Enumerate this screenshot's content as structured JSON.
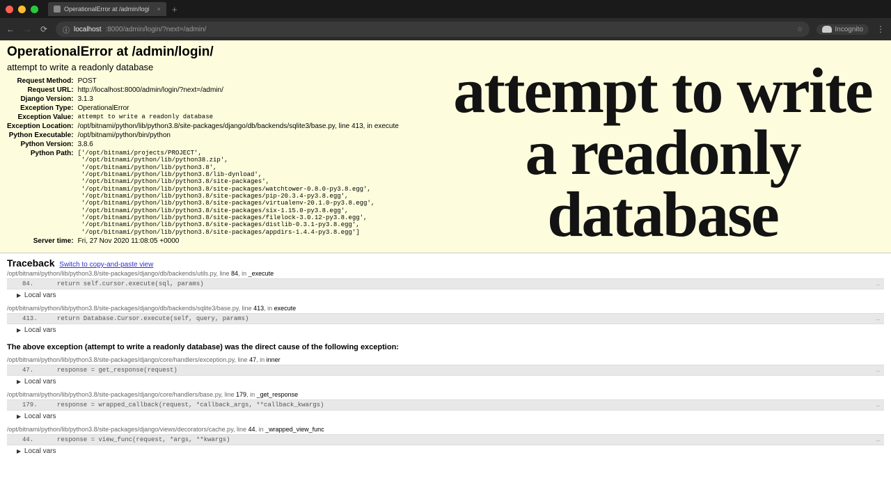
{
  "chrome": {
    "tab_title": "OperationalError at /admin/logi",
    "url_host": "localhost",
    "url_path": ":8000/admin/login/?next=/admin/",
    "incognito_label": "Incognito"
  },
  "summary": {
    "title": "OperationalError at /admin/login/",
    "subtitle": "attempt to write a readonly database",
    "rows": [
      {
        "label": "Request Method:",
        "value": "POST"
      },
      {
        "label": "Request URL:",
        "value": "http://localhost:8000/admin/login/?next=/admin/"
      },
      {
        "label": "Django Version:",
        "value": "3.1.3"
      },
      {
        "label": "Exception Type:",
        "value": "OperationalError"
      },
      {
        "label": "Exception Value:",
        "value": "attempt to write a readonly database",
        "mono": true
      },
      {
        "label": "Exception Location:",
        "value": "/opt/bitnami/python/lib/python3.8/site-packages/django/db/backends/sqlite3/base.py, line 413, in execute"
      },
      {
        "label": "Python Executable:",
        "value": "/opt/bitnami/python/bin/python"
      },
      {
        "label": "Python Version:",
        "value": "3.8.6"
      },
      {
        "label": "Python Path:",
        "value": "['/opt/bitnami/projects/PROJECT',\n '/opt/bitnami/python/lib/python38.zip',\n '/opt/bitnami/python/lib/python3.8',\n '/opt/bitnami/python/lib/python3.8/lib-dynload',\n '/opt/bitnami/python/lib/python3.8/site-packages',\n '/opt/bitnami/python/lib/python3.8/site-packages/watchtower-0.8.0-py3.8.egg',\n '/opt/bitnami/python/lib/python3.8/site-packages/pip-20.3.4-py3.8.egg',\n '/opt/bitnami/python/lib/python3.8/site-packages/virtualenv-20.1.0-py3.8.egg',\n '/opt/bitnami/python/lib/python3.8/site-packages/six-1.15.0-py3.8.egg',\n '/opt/bitnami/python/lib/python3.8/site-packages/filelock-3.0.12-py3.8.egg',\n '/opt/bitnami/python/lib/python3.8/site-packages/distlib-0.3.1-py3.8.egg',\n '/opt/bitnami/python/lib/python3.8/site-packages/appdirs-1.4.4-py3.8.egg']",
        "mono": true
      },
      {
        "label": "Server time:",
        "value": "Fri, 27 Nov 2020 11:08:05 +0000"
      }
    ]
  },
  "traceback": {
    "heading": "Traceback",
    "switch_label": "Switch to copy-and-paste view",
    "chain_text": "The above exception (attempt to write a readonly database) was the direct cause of the following exception:",
    "local_vars_label": "Local vars",
    "frames_a": [
      {
        "loc": "/opt/bitnami/python/lib/python3.8/site-packages/django/db/backends/utils.py",
        "line_word": "line",
        "line": "84",
        "in_word": "in",
        "func": "_execute",
        "ln": "84.",
        "code": "return self.cursor.execute(sql, params)"
      },
      {
        "loc": "/opt/bitnami/python/lib/python3.8/site-packages/django/db/backends/sqlite3/base.py",
        "line_word": "line",
        "line": "413",
        "in_word": "in",
        "func": "execute",
        "ln": "413.",
        "code": "return Database.Cursor.execute(self, query, params)"
      }
    ],
    "frames_b": [
      {
        "loc": "/opt/bitnami/python/lib/python3.8/site-packages/django/core/handlers/exception.py",
        "line_word": "line",
        "line": "47",
        "in_word": "in",
        "func": "inner",
        "ln": "47.",
        "code": "response = get_response(request)"
      },
      {
        "loc": "/opt/bitnami/python/lib/python3.8/site-packages/django/core/handlers/base.py",
        "line_word": "line",
        "line": "179",
        "in_word": "in",
        "func": "_get_response",
        "ln": "179.",
        "code": "response = wrapped_callback(request, *callback_args, **callback_kwargs)"
      },
      {
        "loc": "/opt/bitnami/python/lib/python3.8/site-packages/django/views/decorators/cache.py",
        "line_word": "line",
        "line": "44",
        "in_word": "in",
        "func": "_wrapped_view_func",
        "ln": "44.",
        "code": "response = view_func(request, *args, **kwargs)"
      }
    ]
  },
  "overlay": {
    "text": "attempt to write a readonly database"
  }
}
